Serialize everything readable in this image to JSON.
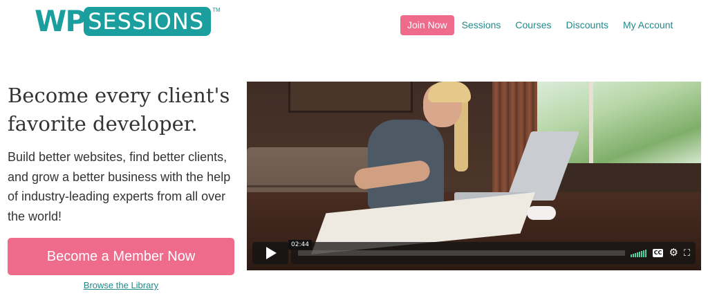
{
  "brand": {
    "logo_wp": "WP",
    "logo_sessions": "SESSIONS",
    "logo_tm": "TM"
  },
  "nav": {
    "join": "Join Now",
    "links": [
      "Sessions",
      "Courses",
      "Discounts",
      "My Account"
    ]
  },
  "hero": {
    "headline": "Become every client's favorite developer.",
    "lead": "Build better websites, find better clients, and grow a better business with the help of industry-leading experts from all over the world!",
    "cta": "Become a Member Now",
    "browse": "Browse the Library"
  },
  "video": {
    "time": "02:44",
    "cc_label": "CC",
    "gear_icon": "⚙",
    "fullscreen_icon": "⛶"
  },
  "colors": {
    "teal": "#1a9e9e",
    "pink": "#ef6b8c",
    "link": "#1f8a8a"
  }
}
